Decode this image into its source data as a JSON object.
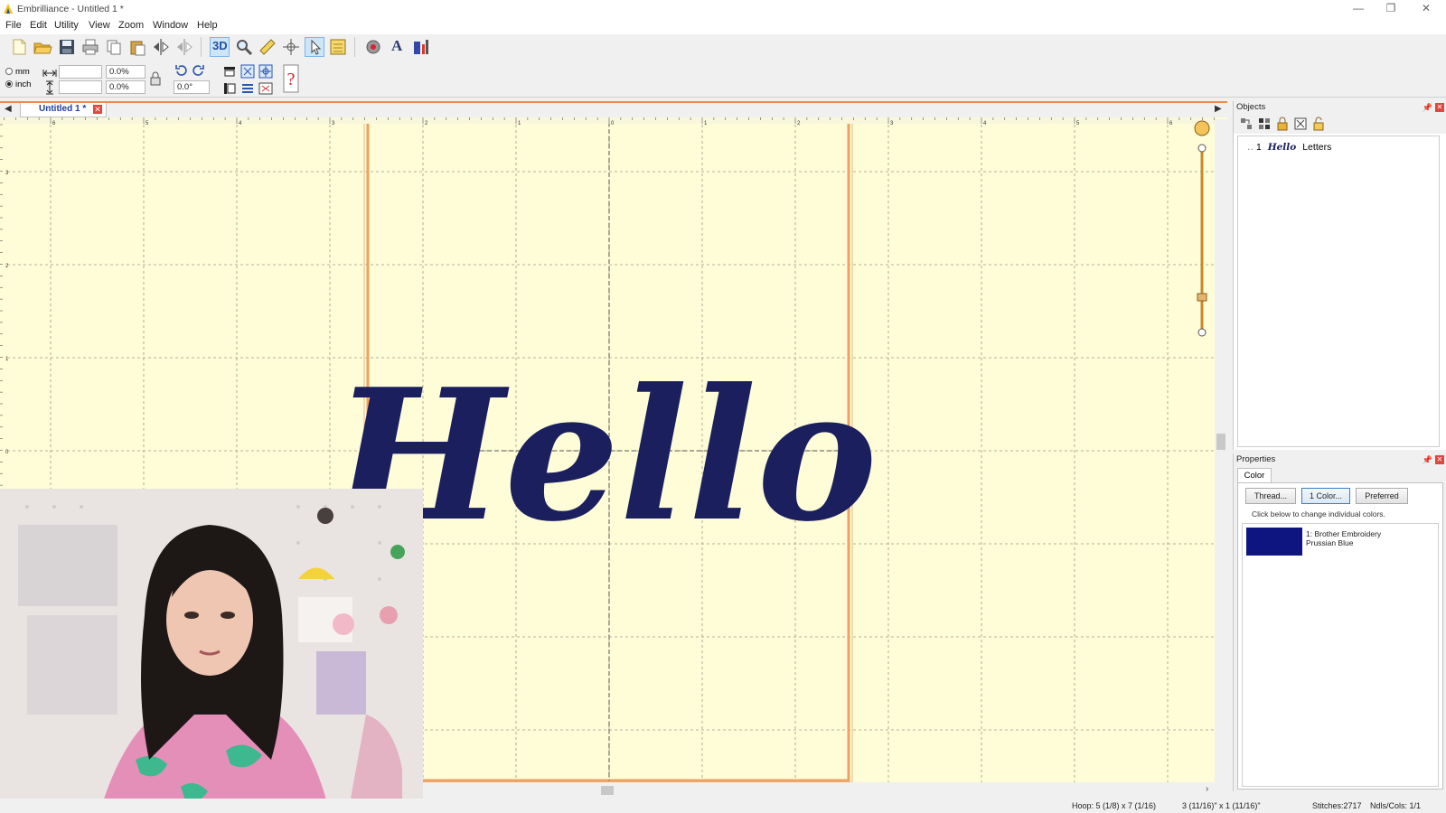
{
  "window": {
    "title": "Embrilliance - Untitled 1 *",
    "controls": {
      "minimize": "—",
      "maximize": "❐",
      "close": "✕"
    }
  },
  "menu": [
    "File",
    "Edit",
    "Utility",
    "View",
    "Zoom",
    "Window",
    "Help"
  ],
  "toolbar": {
    "tool_3d_label": "3D",
    "text_tool_label": "A"
  },
  "units": {
    "mm_label": "mm",
    "inch_label": "inch",
    "selected": "inch"
  },
  "size_fields": {
    "width_value": "",
    "height_value": "",
    "width_percent": "0.0%",
    "height_percent": "0.0%",
    "rotation": "0.0°"
  },
  "document_tab": {
    "label": "Untitled 1 *"
  },
  "canvas": {
    "design_text": "Hello",
    "design_color": "#1b1f5e",
    "background": "#fefdd8",
    "hoop_color": "#f0a060",
    "ruler_labels_top": [
      "6",
      "5",
      "4",
      "3",
      "2",
      "1",
      "0",
      "1",
      "2",
      "3",
      "4",
      "5",
      "6"
    ],
    "ruler_labels_left": [
      "3",
      "2",
      "1",
      "0"
    ]
  },
  "objects_panel": {
    "title": "Objects",
    "items": [
      {
        "index": "1",
        "thumb": "Hello",
        "label": "Letters"
      }
    ]
  },
  "properties_panel": {
    "title": "Properties",
    "tab": "Color",
    "buttons": {
      "thread": "Thread...",
      "one_color": "1 Color...",
      "preferred": "Preferred"
    },
    "hint": "Click below to change individual colors.",
    "colors": [
      {
        "line1": "1: Brother Embroidery",
        "line2": "Prussian Blue",
        "swatch": "#0e1580"
      }
    ]
  },
  "statusbar": {
    "hoop": "Hoop: 5 (1/8) x 7 (1/16)",
    "size": "3 (11/16)\" x 1 (11/16)\"",
    "stitches": "Stitches:2717",
    "needles": "Ndls/Cols: 1/1"
  }
}
